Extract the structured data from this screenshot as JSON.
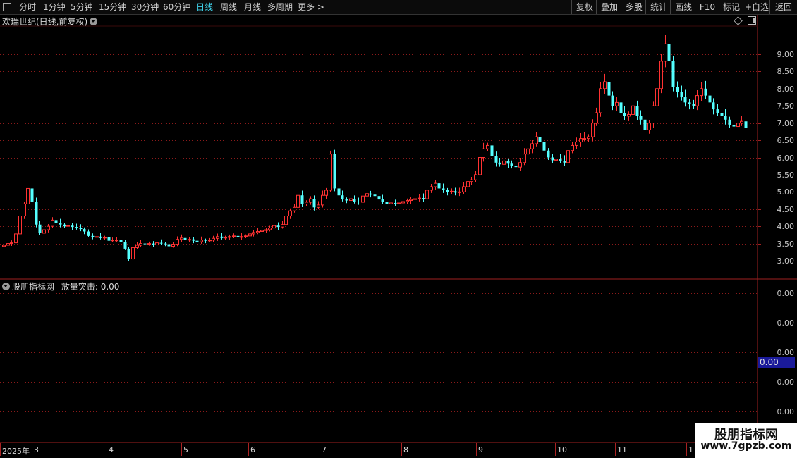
{
  "toolbar": {
    "periods": [
      "分时",
      "1分钟",
      "5分钟",
      "15分钟",
      "30分钟",
      "60分钟",
      "日线",
      "周线",
      "月线",
      "多周期",
      "更多 >"
    ],
    "active_period": "日线",
    "right_buttons": [
      "复权",
      "叠加",
      "多股",
      "统计",
      "画线",
      "F10",
      "标记",
      "+自选",
      "返回"
    ]
  },
  "main_panel": {
    "title": "欢瑞世纪(日线,前复权)",
    "y_labels": [
      "9.00",
      "8.50",
      "8.00",
      "7.50",
      "7.00",
      "6.50",
      "6.00",
      "5.50",
      "5.00",
      "4.50",
      "4.00",
      "3.50",
      "3.00"
    ]
  },
  "sub_panel": {
    "title": "股朋指标网",
    "indicator": "放量突击: 0.00",
    "y_labels": [
      "0.00",
      "0.00",
      "0.00",
      "0.00",
      "0.00"
    ],
    "current_value": "0.00"
  },
  "x_axis": {
    "labels": [
      "2025年",
      "3",
      "4",
      "5",
      "6",
      "7",
      "8",
      "9",
      "10",
      "11",
      "1"
    ]
  },
  "watermark": {
    "line1": "股朋指标网",
    "line2": "www.7gpzb.com"
  },
  "colors": {
    "up": "#ff3232",
    "down": "#54ffff",
    "grid": "#8b1a1a",
    "active": "#3fd0e8"
  },
  "chart_data": {
    "type": "candlestick",
    "title": "欢瑞世纪(日线,前复权)",
    "ylim": [
      2.7,
      9.8
    ],
    "closes": [
      3.45,
      3.5,
      3.52,
      3.78,
      4.3,
      4.65,
      5.1,
      4.72,
      4.05,
      3.8,
      3.9,
      4.0,
      4.18,
      4.1,
      4.05,
      4.0,
      4.02,
      3.98,
      3.95,
      3.92,
      3.85,
      3.72,
      3.68,
      3.7,
      3.66,
      3.68,
      3.58,
      3.6,
      3.6,
      3.55,
      3.35,
      3.05,
      3.38,
      3.45,
      3.5,
      3.48,
      3.5,
      3.46,
      3.52,
      3.5,
      3.48,
      3.42,
      3.48,
      3.62,
      3.66,
      3.6,
      3.62,
      3.58,
      3.55,
      3.6,
      3.58,
      3.6,
      3.65,
      3.7,
      3.66,
      3.68,
      3.7,
      3.72,
      3.68,
      3.7,
      3.72,
      3.78,
      3.82,
      3.85,
      3.88,
      3.9,
      3.95,
      4.02,
      3.98,
      4.05,
      4.3,
      4.45,
      4.55,
      4.9,
      4.65,
      4.7,
      4.8,
      4.55,
      4.62,
      4.9,
      5.05,
      6.1,
      5.1,
      4.9,
      4.78,
      4.75,
      4.8,
      4.72,
      4.7,
      4.88,
      4.95,
      4.92,
      4.88,
      4.78,
      4.72,
      4.65,
      4.68,
      4.66,
      4.68,
      4.72,
      4.75,
      4.78,
      4.8,
      4.82,
      4.8,
      5.05,
      5.15,
      5.25,
      5.1,
      5.05,
      5.0,
      5.02,
      4.98,
      5.0,
      5.15,
      5.3,
      5.35,
      5.5,
      6.0,
      6.25,
      6.35,
      6.05,
      5.85,
      5.8,
      5.9,
      5.82,
      5.75,
      5.72,
      5.85,
      6.1,
      6.25,
      6.4,
      6.6,
      6.45,
      6.2,
      6.0,
      5.92,
      5.95,
      5.9,
      5.85,
      6.2,
      6.35,
      6.45,
      6.55,
      6.55,
      6.6,
      7.0,
      7.3,
      8.0,
      8.2,
      7.8,
      7.5,
      7.6,
      7.3,
      7.2,
      7.25,
      7.5,
      7.2,
      7.1,
      6.8,
      7.0,
      7.5,
      8.0,
      8.8,
      9.3,
      8.8,
      8.05,
      7.9,
      7.75,
      7.6,
      7.55,
      7.5,
      7.8,
      8.0,
      7.8,
      7.6,
      7.4,
      7.3,
      7.2,
      7.1,
      6.95,
      6.9,
      7.0,
      7.05,
      6.85
    ]
  }
}
